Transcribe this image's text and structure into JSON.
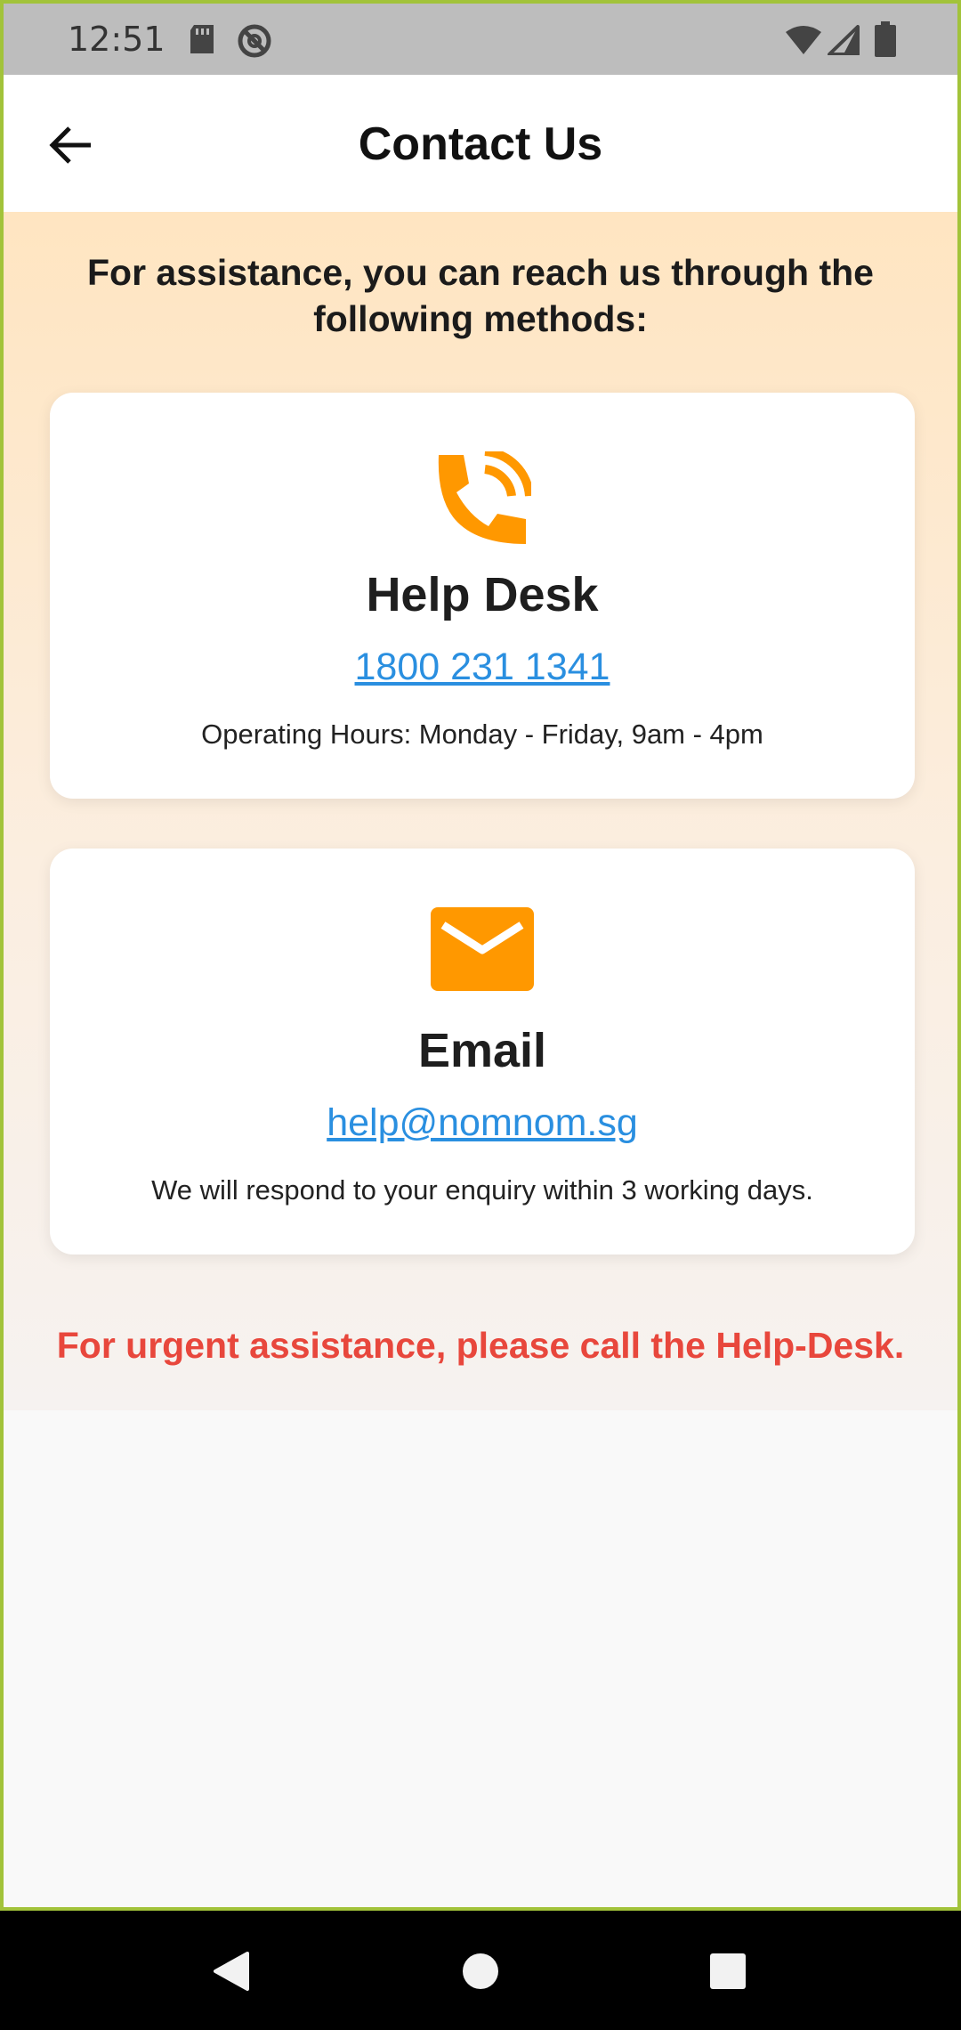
{
  "status_bar": {
    "time": "12:51",
    "icons": [
      "sd-card-icon",
      "do-not-disturb-icon",
      "wifi-icon",
      "cellular-signal-icon",
      "battery-icon"
    ]
  },
  "app_bar": {
    "title": "Contact Us",
    "back_icon": "arrow-left-icon"
  },
  "intro_text": "For assistance, you can reach us through the following methods:",
  "cards": [
    {
      "icon": "phone-call-icon",
      "title": "Help Desk",
      "link": "1800 231 1341",
      "note": "Operating Hours: Monday - Friday, 9am - 4pm"
    },
    {
      "icon": "email-icon",
      "title": "Email",
      "link": "help@nomnom.sg",
      "note": "We will respond to your enquiry within 3 working days."
    }
  ],
  "urgent_text": "For urgent assistance, please call the Help-Desk.",
  "nav_bar": {
    "icons": [
      "back-triangle-icon",
      "home-circle-icon",
      "recents-square-icon"
    ]
  },
  "colors": {
    "accent": "#ff9800",
    "link": "#2a8fe0",
    "urgent": "#e8473c",
    "frame": "#a2c33a"
  }
}
